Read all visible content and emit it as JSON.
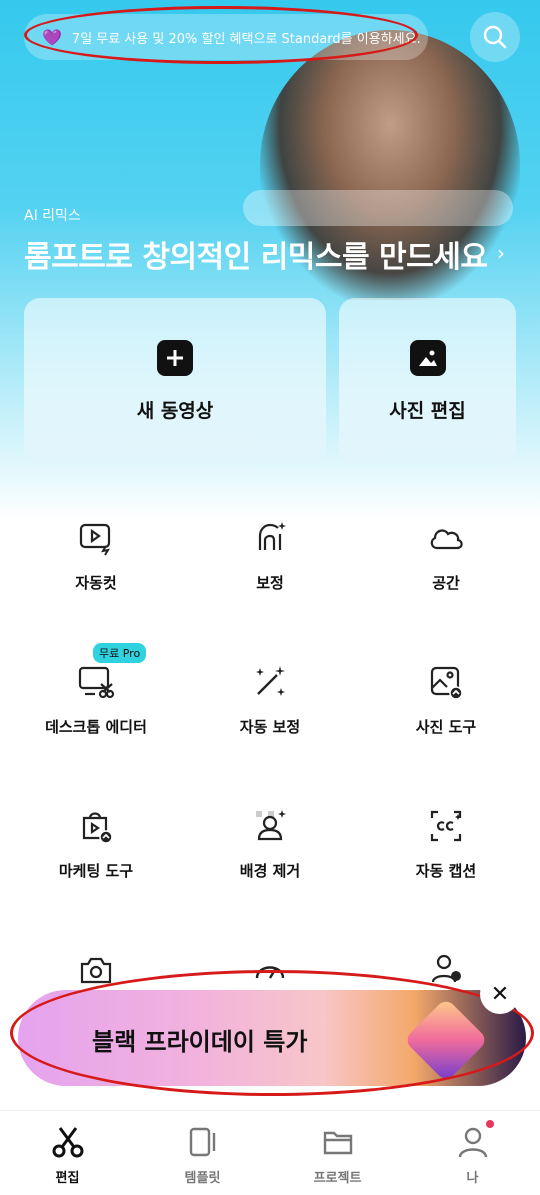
{
  "promo": {
    "text": "7일 무료 사용 및 20% 할인 혜택으로 Standard를 이용하세요.",
    "icon": "gem-icon"
  },
  "hero": {
    "label": "AI 리믹스",
    "title": "롬프트로 창의적인 리믹스를 만드세요",
    "arrow": "›"
  },
  "cards": [
    {
      "label": "새 동영상",
      "icon": "plus-icon"
    },
    {
      "label": "사진 편집",
      "icon": "image-icon"
    }
  ],
  "tools": [
    {
      "label": "자동컷"
    },
    {
      "label": "보정"
    },
    {
      "label": "공간"
    },
    {
      "label": "데스크톱 에디터",
      "badge": "무료 Pro"
    },
    {
      "label": "자동 보정"
    },
    {
      "label": "사진 도구"
    },
    {
      "label": "마케팅 도구"
    },
    {
      "label": "배경 제거"
    },
    {
      "label": "자동 캡션"
    }
  ],
  "banner": {
    "text": "블랙 프라이데이 특가",
    "close": "✕"
  },
  "nav": [
    {
      "label": "편집"
    },
    {
      "label": "템플릿"
    },
    {
      "label": "프로젝트"
    },
    {
      "label": "나"
    }
  ],
  "colors": {
    "accent": "#2ed3df",
    "annotation": "#d61a1a",
    "notification": "#e8365a"
  }
}
